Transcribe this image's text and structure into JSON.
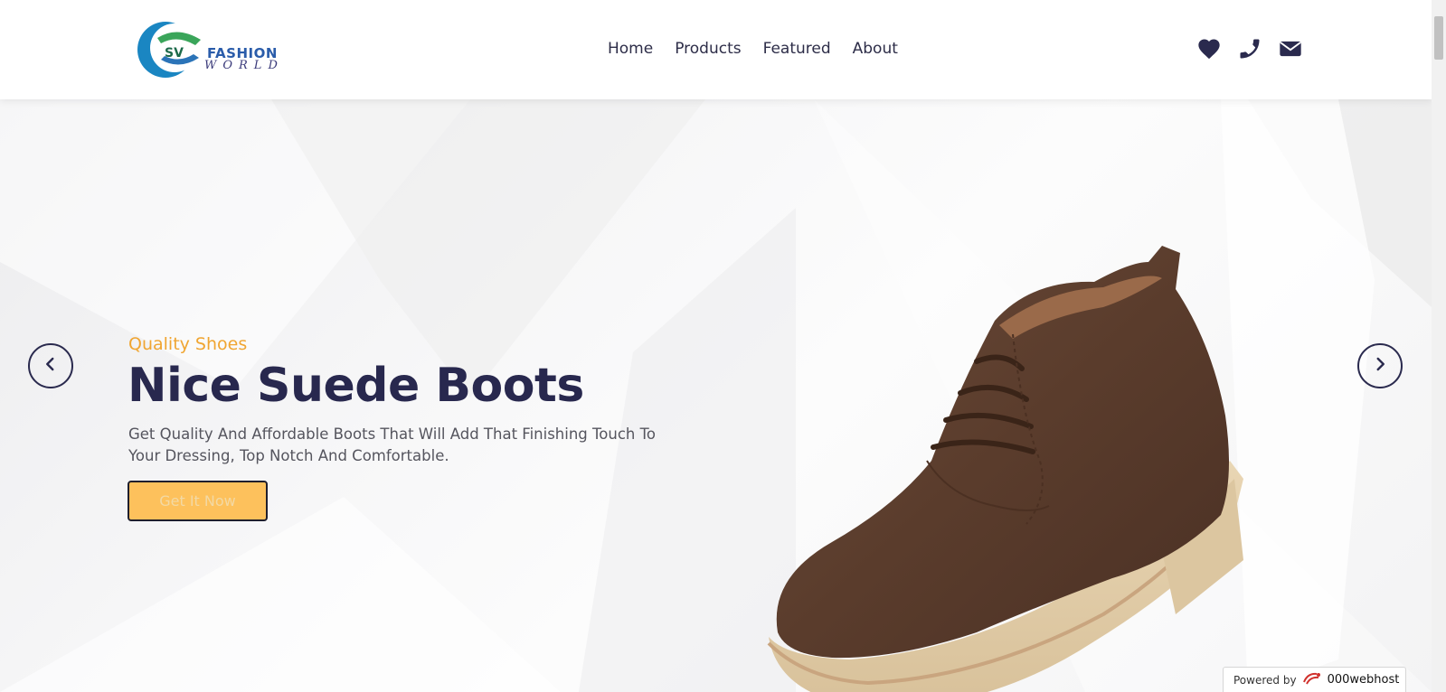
{
  "brand": {
    "logo_sv": "SV",
    "logo_fashion": "FASHION",
    "logo_world": "WORLD"
  },
  "nav": {
    "items": [
      {
        "label": "Home"
      },
      {
        "label": "Products"
      },
      {
        "label": "Featured"
      },
      {
        "label": "About"
      }
    ]
  },
  "header_icons": [
    "heart-icon",
    "phone-icon",
    "envelope-icon"
  ],
  "hero": {
    "subtitle": "Quality Shoes",
    "title": "Nice Suede Boots",
    "description": "Get Quality And Affordable Boots That Will Add That Finishing Touch To Your Dressing, Top Notch And Comfortable.",
    "cta_label": "Get It Now"
  },
  "carousel": {
    "prev_icon": "chevron-left-icon",
    "next_icon": "chevron-right-icon"
  },
  "badge": {
    "prefix": "Powered by",
    "brand": "000webhost"
  },
  "colors": {
    "accent": "#f0a531",
    "cta_fill": "#fdc15c",
    "primary_text": "#28284e",
    "nav_text": "#2d2d48"
  }
}
